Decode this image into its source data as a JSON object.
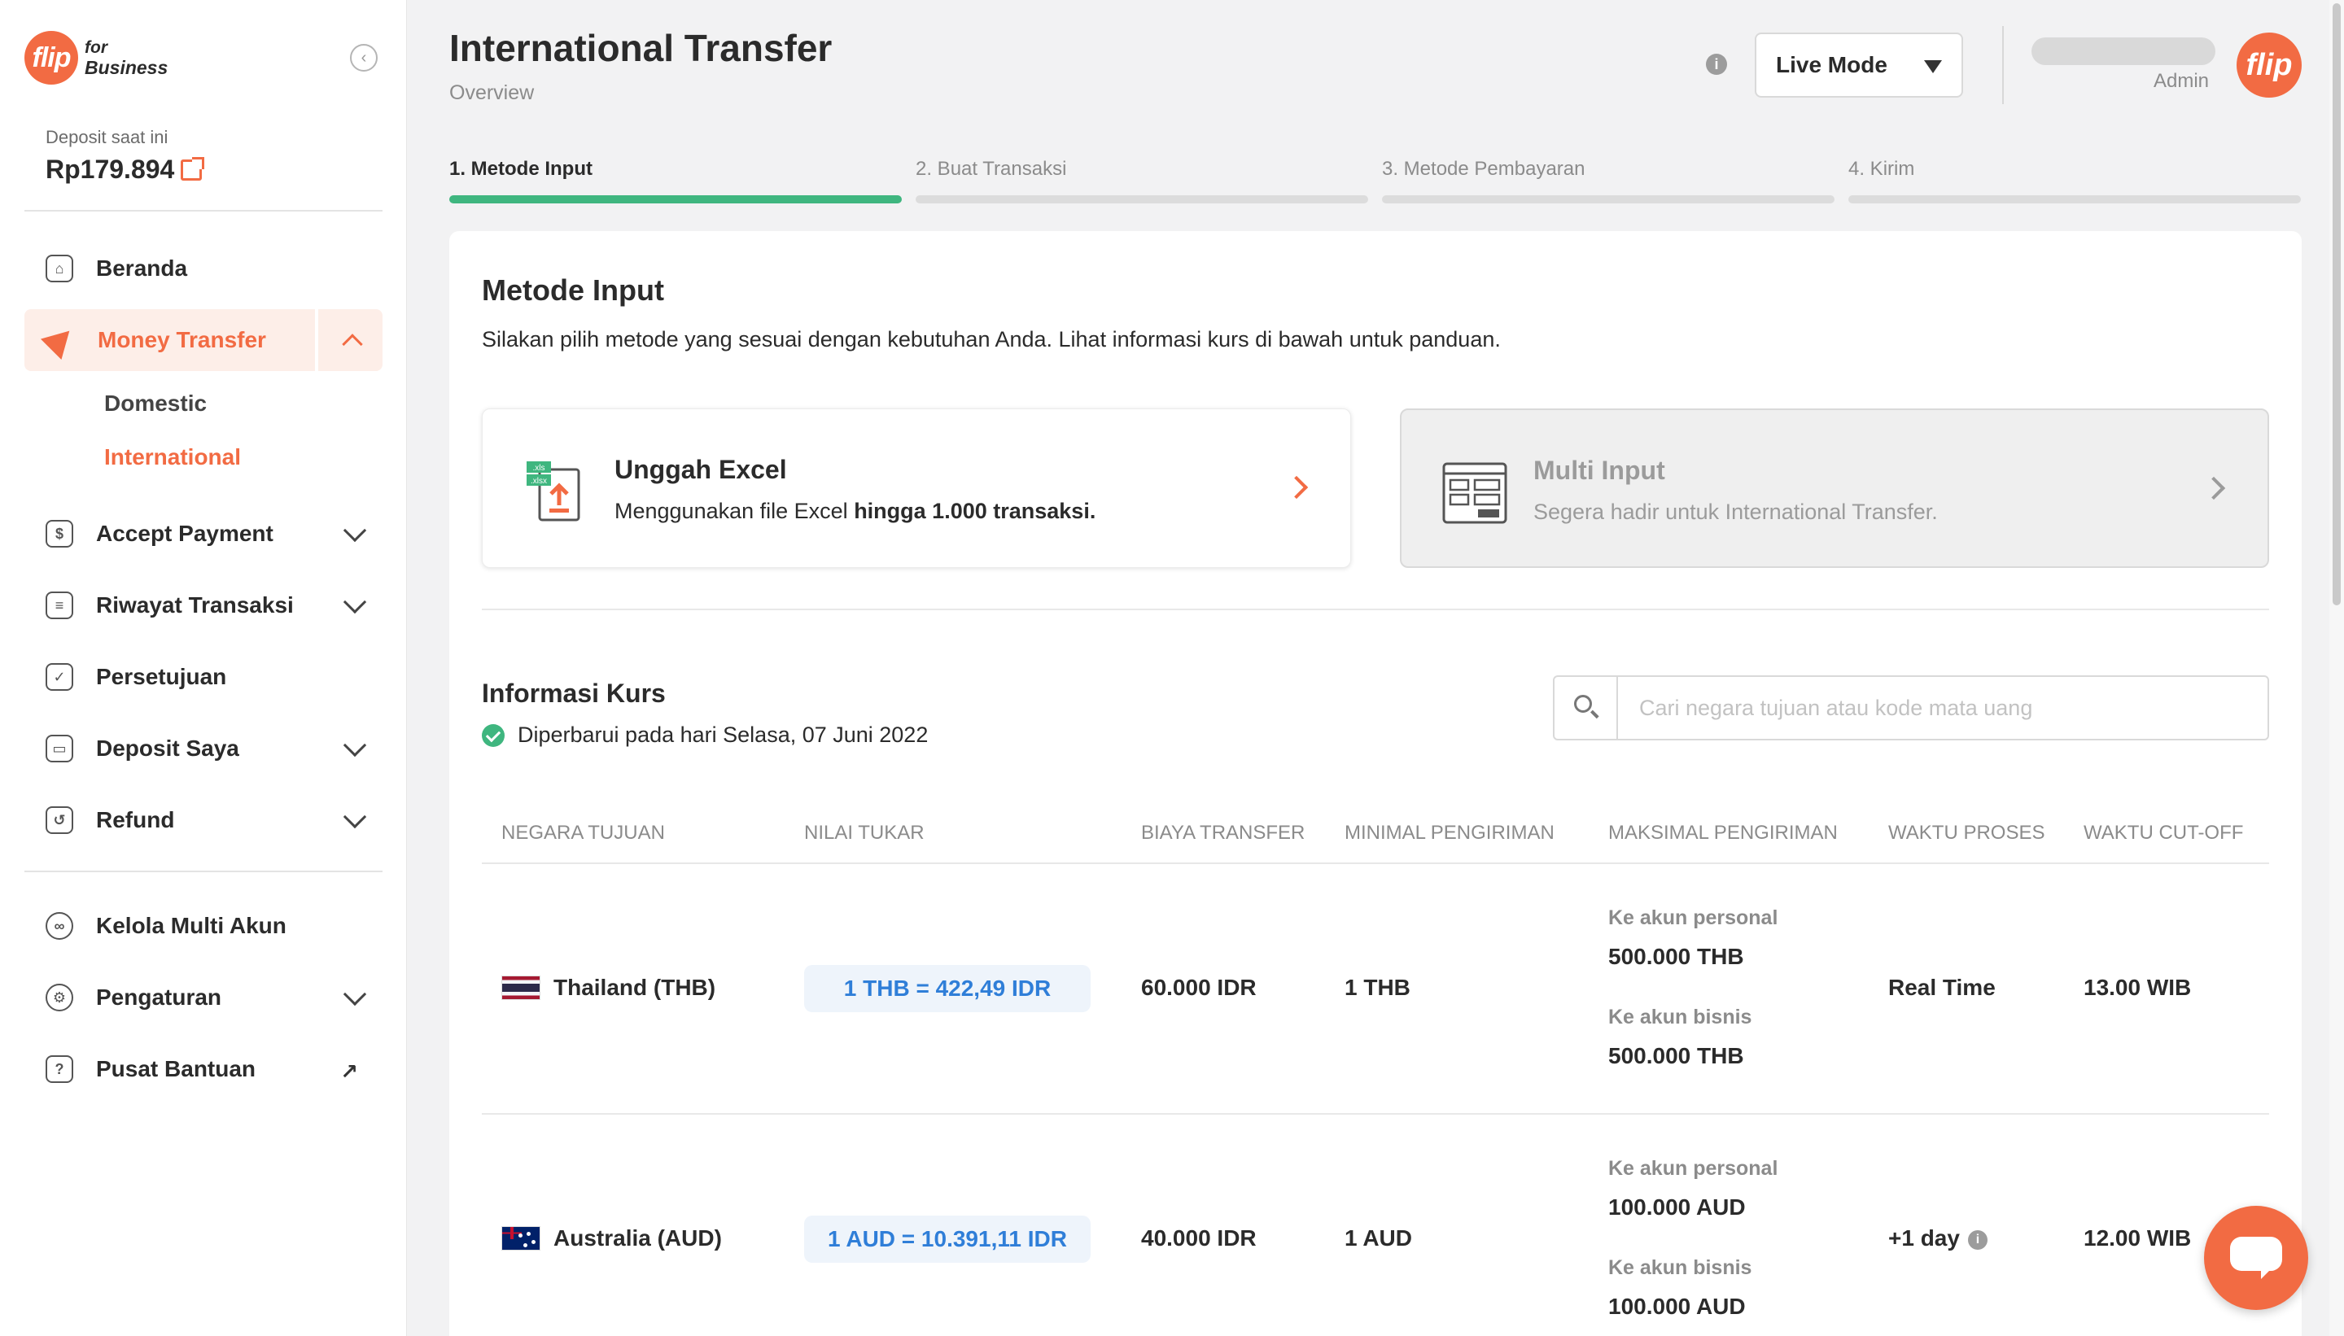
{
  "brand": {
    "logo_text": "flip",
    "for": "for",
    "business": "Business"
  },
  "sidebar": {
    "deposit_label": "Deposit saat ini",
    "deposit_value": "Rp179.894",
    "items": [
      {
        "label": "Beranda",
        "icon": "home-icon"
      },
      {
        "label": "Money Transfer",
        "icon": "send-icon"
      },
      {
        "label": "Accept Payment",
        "icon": "payment-icon"
      },
      {
        "label": "Riwayat Transaksi",
        "icon": "history-icon"
      },
      {
        "label": "Persetujuan",
        "icon": "approval-icon"
      },
      {
        "label": "Deposit Saya",
        "icon": "wallet-icon"
      },
      {
        "label": "Refund",
        "icon": "refund-icon"
      },
      {
        "label": "Kelola Multi Akun",
        "icon": "users-icon"
      },
      {
        "label": "Pengaturan",
        "icon": "gear-icon"
      },
      {
        "label": "Pusat Bantuan",
        "icon": "help-icon"
      }
    ],
    "sub_items": [
      "Domestic",
      "International"
    ]
  },
  "header": {
    "title": "International Transfer",
    "subtitle": "Overview",
    "mode": "Live Mode",
    "user_role": "Admin",
    "avatar_text": "flip"
  },
  "steps": [
    "1. Metode Input",
    "2. Buat Transaksi",
    "3. Metode Pembayaran",
    "4. Kirim"
  ],
  "main": {
    "title": "Metode Input",
    "description": "Silakan pilih metode yang sesuai dengan kebutuhan Anda. Lihat informasi kurs di bawah untuk panduan.",
    "methods": [
      {
        "title": "Unggah Excel",
        "desc_prefix": "Menggunakan file Excel ",
        "desc_bold": "hingga 1.000 transaksi."
      },
      {
        "title": "Multi Input",
        "desc": "Segera hadir untuk International Transfer."
      }
    ],
    "kurs_title": "Informasi Kurs",
    "kurs_updated": "Diperbarui pada hari Selasa, 07 Juni 2022",
    "search_placeholder": "Cari negara tujuan atau kode mata uang"
  },
  "table": {
    "headers": [
      "NEGARA TUJUAN",
      "NILAI TUKAR",
      "BIAYA TRANSFER",
      "MINIMAL PENGIRIMAN",
      "MAKSIMAL PENGIRIMAN",
      "WAKTU PROSES",
      "WAKTU CUT-OFF"
    ],
    "rows": [
      {
        "country": "Thailand (THB)",
        "rate": "1 THB = 422,49 IDR",
        "fee": "60.000 IDR",
        "min": "1 THB",
        "max_personal_label": "Ke akun personal",
        "max_personal": "500.000 THB",
        "max_business_label": "Ke akun bisnis",
        "max_business": "500.000 THB",
        "process": "Real Time",
        "cutoff": "13.00 WIB"
      },
      {
        "country": "Australia (AUD)",
        "rate": "1 AUD = 10.391,11 IDR",
        "fee": "40.000 IDR",
        "min": "1 AUD",
        "max_personal_label": "Ke akun personal",
        "max_personal": "100.000 AUD",
        "max_business_label": "Ke akun bisnis",
        "max_business": "100.000 AUD",
        "process": "+1 day",
        "cutoff": "12.00 WIB"
      }
    ]
  },
  "colors": {
    "accent": "#f26b43",
    "success": "#3fb67f",
    "link": "#2f7ed8"
  }
}
